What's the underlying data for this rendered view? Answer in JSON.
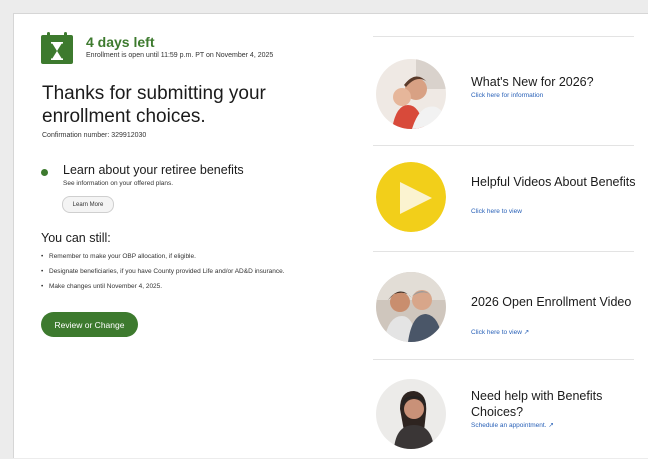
{
  "status": {
    "days_left": "4 days left",
    "enrollment_note": "Enrollment is open until 11:59 p.m. PT on November 4, 2025"
  },
  "confirmation": {
    "heading": "Thanks for submitting your enrollment choices.",
    "number_text": "Confirmation number: 329912030"
  },
  "retiree": {
    "title": "Learn about your retiree benefits",
    "subtitle": "See information on your offered plans.",
    "button_label": "Learn More"
  },
  "you_can_still": {
    "heading": "You can still:",
    "items": [
      "Remember to make your OBP allocation, if eligible.",
      "Designate beneficiaries, if you have County provided Life and/or AD&D insurance.",
      "Make changes until November 4, 2025."
    ]
  },
  "review_button": "Review or Change",
  "cards": [
    {
      "title": "What's New for 2026?",
      "link": "Click here for information"
    },
    {
      "title": "Helpful Videos About Benefits",
      "link": "Click here to view"
    },
    {
      "title": "2026 Open Enrollment Video",
      "link": "Click here to view ↗"
    },
    {
      "title": "Need help with Benefits Choices?",
      "link": "Schedule an appointment. ↗"
    }
  ],
  "colors": {
    "accent_green": "#3d7a2e",
    "link_blue": "#2a62b8",
    "play_yellow": "#f2cf1a"
  }
}
